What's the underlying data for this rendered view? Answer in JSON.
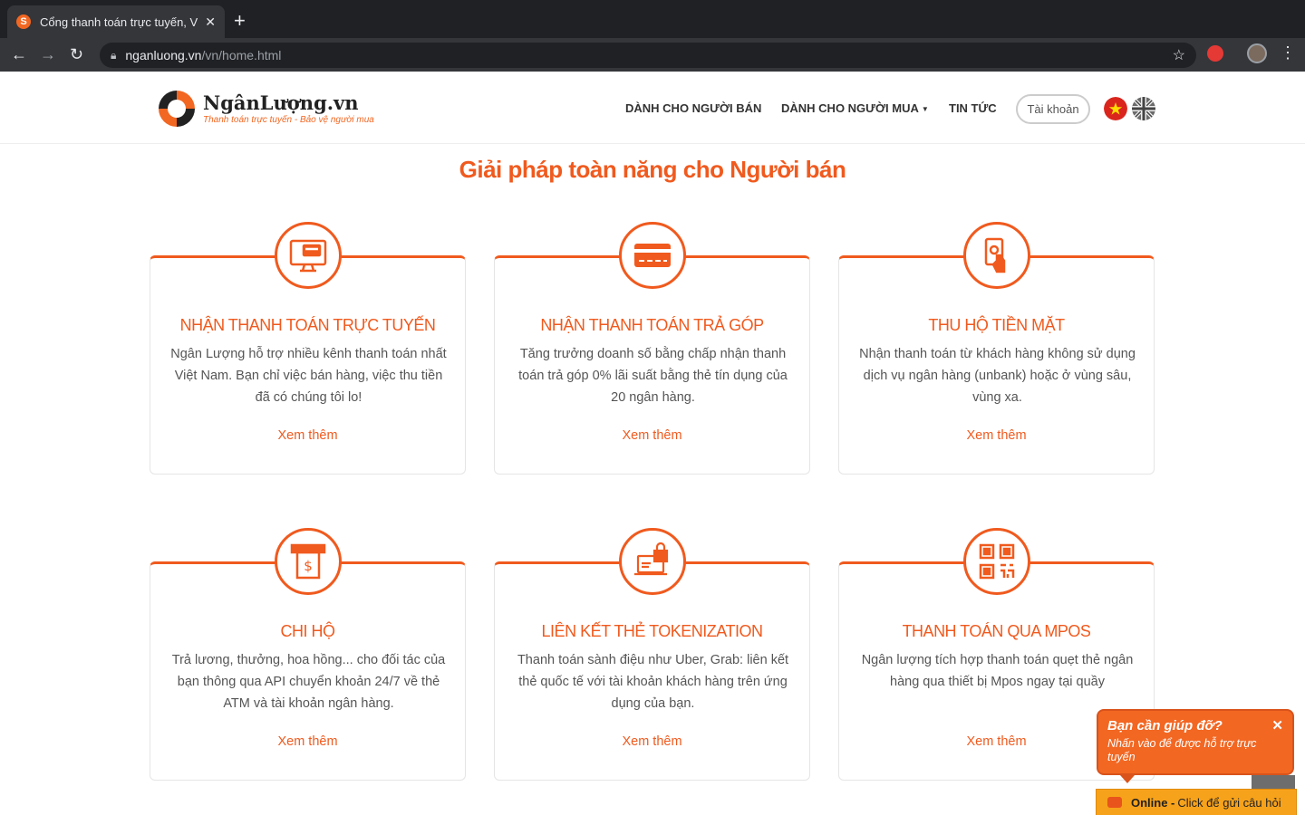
{
  "browser": {
    "tab_title": "Cổng thanh toán trực tuyến, Ví",
    "tab_close": "✕",
    "new_tab": "+",
    "url_host": "nganluong.vn",
    "url_path": "/vn/home.html",
    "icons": [
      "back-arrow-icon",
      "forward-arrow-icon",
      "reload-icon",
      "lock-icon",
      "star-icon",
      "extension-icon",
      "profile-avatar",
      "menu-dots-icon"
    ]
  },
  "header": {
    "logo_brand": "NgânLượng.vn",
    "logo_tagline": "Thanh toán trực tuyến - Bảo vệ người mua",
    "nav": {
      "sellers": "DÀNH CHO NGƯỜI BÁN",
      "buyers": "DÀNH CHO NGƯỜI MUA",
      "news": "TIN TỨC"
    },
    "account": "Tài khoản",
    "flags": [
      "vietnam-flag",
      "uk-flag"
    ]
  },
  "section_title": "Giải pháp toàn năng cho Người bán",
  "cards": [
    {
      "icon": "monitor-card-icon",
      "title": "NHẬN THANH TOÁN TRỰC TUYẾN",
      "desc": "Ngân Lượng hỗ trợ nhiều kênh thanh toán nhất Việt Nam. Bạn chỉ việc bán hàng, việc thu tiền đã có chúng tôi lo!",
      "more": "Xem thêm"
    },
    {
      "icon": "credit-card-icon",
      "title": "NHẬN THANH TOÁN TRẢ GÓP",
      "desc": "Tăng trưởng doanh số bằng chấp nhận thanh toán trả góp 0% lãi suất bằng thẻ tín dụng của 20 ngân hàng.",
      "more": "Xem thêm"
    },
    {
      "icon": "cash-hand-icon",
      "title": "THU HỘ TIỀN MẶT",
      "desc": "Nhận thanh toán từ khách hàng không sử dụng dịch vụ ngân hàng (unbank) hoặc ở vùng sâu, vùng xa.",
      "more": "Xem thêm"
    },
    {
      "icon": "atm-cash-icon",
      "title": "CHI HỘ",
      "desc": "Trả lương, thưởng, hoa hồng... cho đối tác của bạn thông qua API chuyển khoản 24/7 về thẻ ATM và tài khoản ngân hàng.",
      "more": "Xem thêm"
    },
    {
      "icon": "laptop-lock-icon",
      "title": "LIÊN KẾT THẺ TOKENIZATION",
      "desc": "Thanh toán sành điệu như Uber, Grab: liên kết thẻ quốc tế với tài khoản khách hàng trên ứng dụng của bạn.",
      "more": "Xem thêm"
    },
    {
      "icon": "qr-code-icon",
      "title": "THANH TOÁN QUA MPOS",
      "desc": "Ngân lượng tích hợp thanh toán quẹt thẻ ngân hàng qua thiết bị Mpos ngay tại quầy",
      "more": "Xem thêm"
    }
  ],
  "help": {
    "title": "Bạn cần giúp đỡ?",
    "subtitle": "Nhấn vào để được hỗ trợ trực tuyến",
    "close": "✕",
    "online_label": "Online -",
    "online_text": "Click để gửi câu hỏi"
  },
  "colors": {
    "accent": "#f05a1e",
    "chat_bar": "#f7a21b",
    "chrome_dark": "#202124"
  }
}
